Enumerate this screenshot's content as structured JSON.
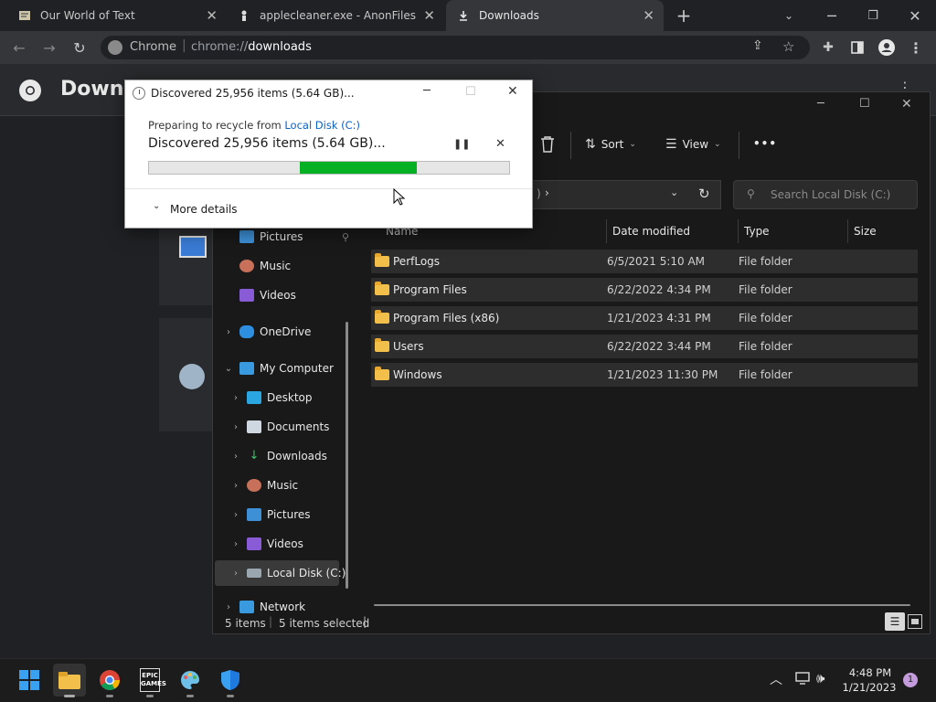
{
  "browser": {
    "tabs": [
      {
        "title": "Our World of Text",
        "icon": "ow-icon"
      },
      {
        "title": "applecleaner.exe - AnonFiles",
        "icon": "anonfiles-icon"
      },
      {
        "title": "Downloads",
        "icon": "download-icon"
      }
    ],
    "new_tab": "+",
    "omnibox": {
      "prefix": "Chrome",
      "scheme": "chrome://",
      "path": "downloads"
    },
    "page_title": "Downloads"
  },
  "explorer": {
    "toolbar": {
      "sort_label": "Sort",
      "view_label": "View",
      "more": "•••"
    },
    "address_chevron": ")",
    "search_placeholder": "Search Local Disk (C:)",
    "columns": {
      "name": "Name",
      "date": "Date modified",
      "type": "Type",
      "size": "Size"
    },
    "nav": [
      {
        "label": "Pictures",
        "icon": "pictures-icon",
        "pinned": true
      },
      {
        "label": "Music",
        "icon": "music-icon"
      },
      {
        "label": "Videos",
        "icon": "videos-icon"
      },
      {
        "label": "OneDrive",
        "icon": "onedrive-icon"
      },
      {
        "label": "My Computer",
        "icon": "computer-icon"
      },
      {
        "label": "Desktop",
        "icon": "desktop-icon"
      },
      {
        "label": "Documents",
        "icon": "documents-icon"
      },
      {
        "label": "Downloads",
        "icon": "downloads-icon"
      },
      {
        "label": "Music",
        "icon": "music-icon"
      },
      {
        "label": "Pictures",
        "icon": "pictures-icon"
      },
      {
        "label": "Videos",
        "icon": "videos-icon"
      },
      {
        "label": "Local Disk (C:)",
        "icon": "disk-icon"
      },
      {
        "label": "Network",
        "icon": "network-icon"
      }
    ],
    "rows": [
      {
        "name": "PerfLogs",
        "date": "6/5/2021 5:10 AM",
        "type": "File folder"
      },
      {
        "name": "Program Files",
        "date": "6/22/2022 4:34 PM",
        "type": "File folder"
      },
      {
        "name": "Program Files (x86)",
        "date": "1/21/2023 4:31 PM",
        "type": "File folder"
      },
      {
        "name": "Users",
        "date": "6/22/2022 3:44 PM",
        "type": "File folder"
      },
      {
        "name": "Windows",
        "date": "1/21/2023 11:30 PM",
        "type": "File folder"
      }
    ],
    "status": {
      "count": "5 items",
      "selected": "5 items selected"
    }
  },
  "dialog": {
    "title": "Discovered 25,956 items (5.64 GB)...",
    "subtitle_prefix": "Preparing to recycle from ",
    "subtitle_link": "Local Disk (C:)",
    "headline": "Discovered 25,956 items (5.64 GB)...",
    "progress": {
      "fill_start": 0.42,
      "fill_end": 0.745
    },
    "more_details": "More details",
    "colors": {
      "progress": "#06b025",
      "link": "#0b62c4"
    }
  },
  "taskbar": {
    "time": "4:48 PM",
    "date": "1/21/2023",
    "notification_count": "1"
  }
}
